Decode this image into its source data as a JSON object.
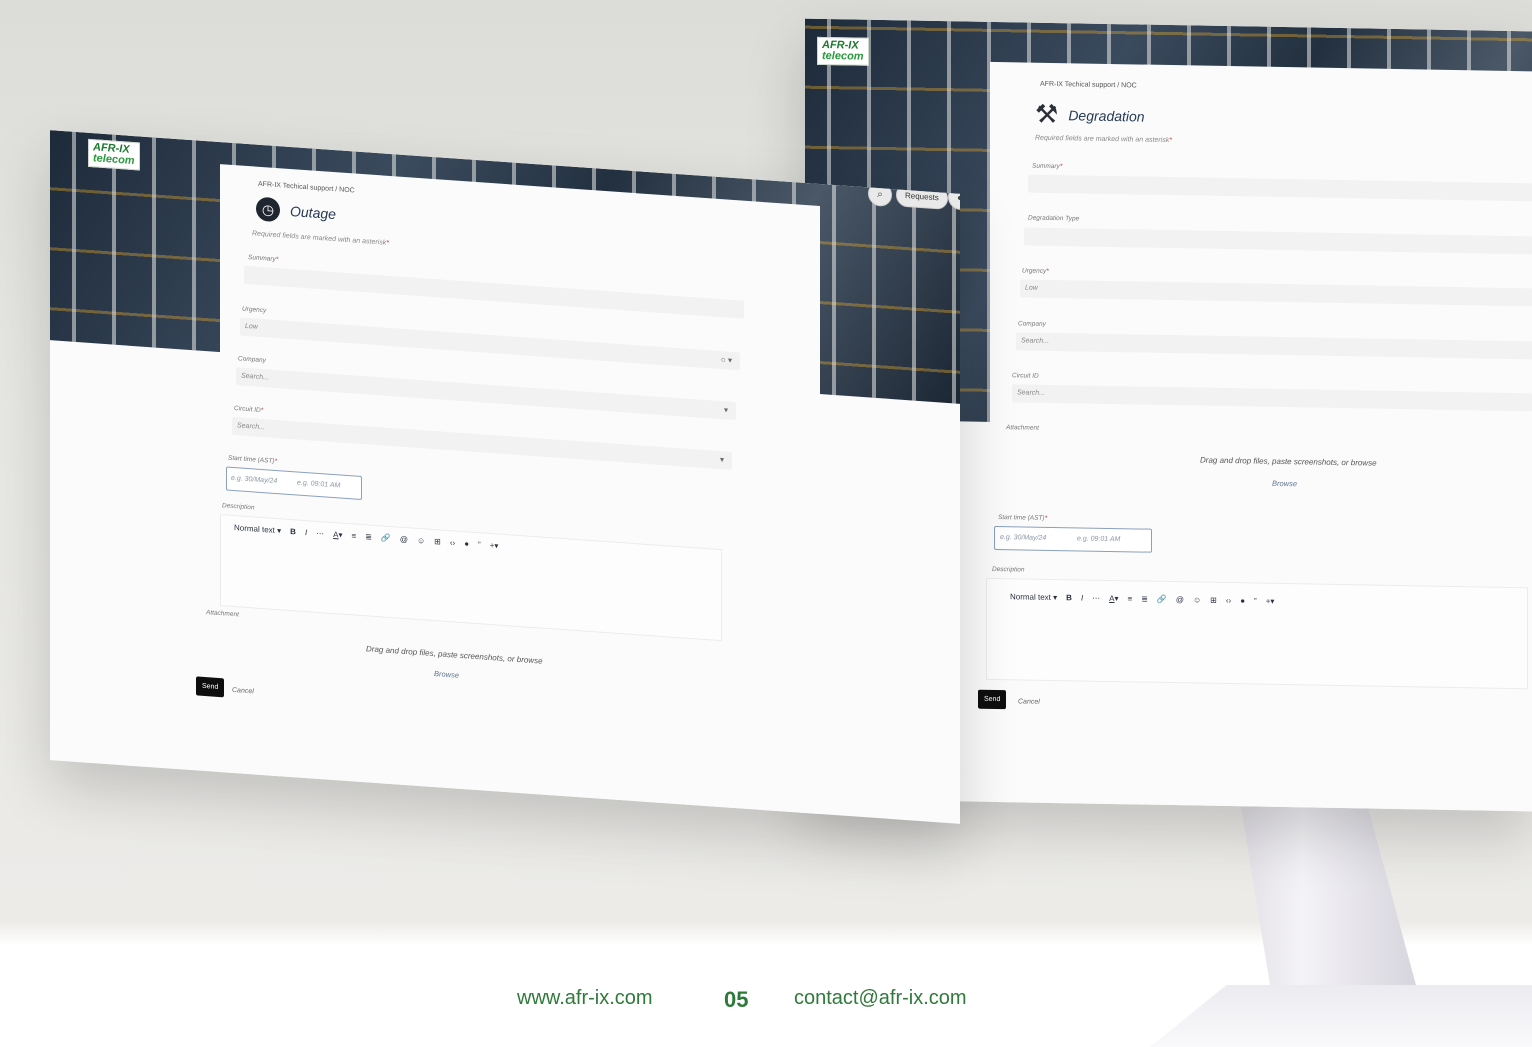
{
  "left_screen": {
    "logo": {
      "line1": "AFR-IX",
      "line2": "telecom"
    },
    "breadcrumb": "AFR-IX Techical support  /  NOC",
    "title": "Outage",
    "required_note": "Required fields are marked with an asterisk",
    "summary_label": "Summary",
    "urgency_label": "Urgency",
    "urgency_value": "Low",
    "company_label": "Company",
    "company_placeholder": "Search...",
    "circuit_label": "Circuit ID",
    "circuit_placeholder": "Search...",
    "start_time_label": "Start time (AST)",
    "date_placeholder": "e.g. 30/May/24",
    "time_placeholder": "e.g. 09:01 AM",
    "description_label": "Description",
    "toolbar_text_style": "Normal text",
    "attachment_label": "Attachment",
    "drop_text": "Drag and drop files, paste screenshots, or browse",
    "browse_label": "Browse",
    "send_label": "Send",
    "cancel_label": "Cancel",
    "requests_label": "Requests"
  },
  "right_screen": {
    "logo": {
      "line1": "AFR-IX",
      "line2": "telecom"
    },
    "breadcrumb": "AFR-IX Techical support  /  NOC",
    "title": "Degradation",
    "required_note": "Required fields are marked with an asterisk",
    "summary_label": "Summary",
    "degradation_type_label": "Degradation Type",
    "urgency_label": "Urgency",
    "urgency_value": "Low",
    "company_label": "Company",
    "company_placeholder": "Search...",
    "circuit_label": "Circuit ID",
    "circuit_placeholder": "Search...",
    "attachment_label": "Attachment",
    "drop_text": "Drag and drop files, paste screenshots, or browse",
    "browse_label": "Browse",
    "start_time_label": "Start time (AST)",
    "date_placeholder": "e.g. 30/May/24",
    "time_placeholder": "e.g. 09:01 AM",
    "description_label": "Description",
    "toolbar_text_style": "Normal text",
    "send_label": "Send",
    "cancel_label": "Cancel"
  },
  "footer": {
    "website": "www.afr-ix.com",
    "page_number": "05",
    "email": "contact@afr-ix.com"
  },
  "colors": {
    "brand_green": "#2f7a3a",
    "send_button": "#0e0e0e"
  }
}
